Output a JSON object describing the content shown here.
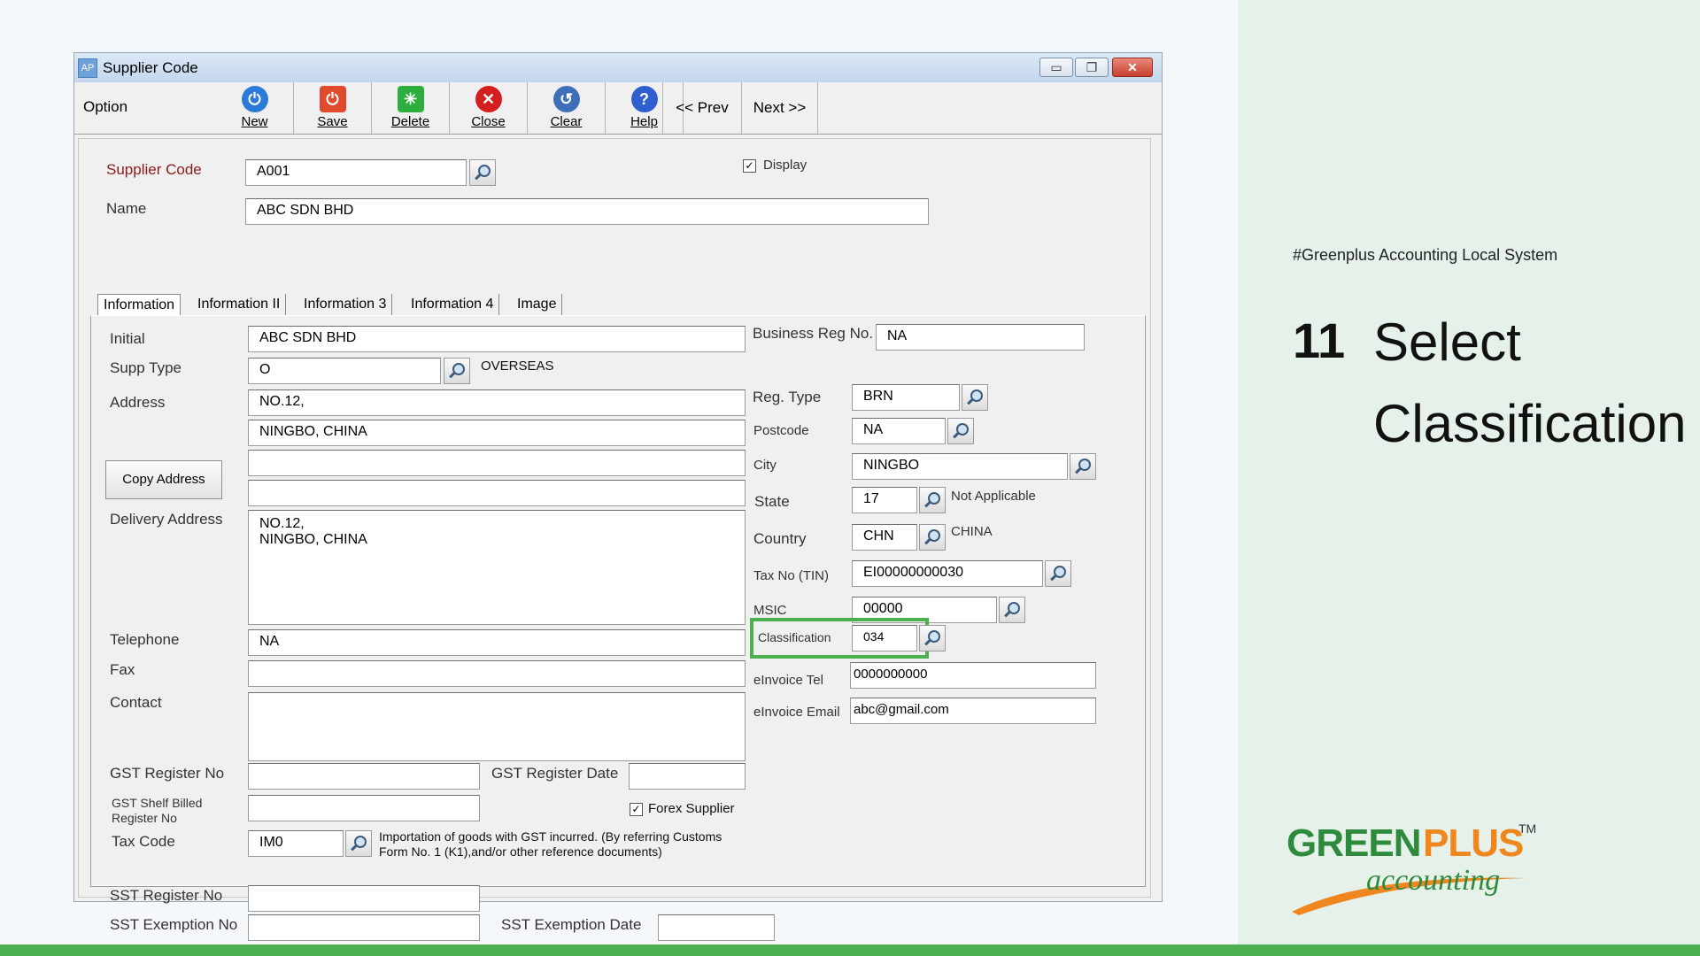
{
  "window": {
    "app_icon": "AP",
    "title": "Supplier Code",
    "controls": {
      "minimize": "▭",
      "maximize": "❐",
      "close": "✕"
    }
  },
  "toolbar": {
    "option_label": "Option",
    "buttons": [
      {
        "label": "New",
        "icon": "power-icon",
        "color": "#2a7ad8"
      },
      {
        "label": "Save",
        "icon": "save-icon",
        "color": "#e04b2e"
      },
      {
        "label": "Delete",
        "icon": "delete-icon",
        "color": "#2eae3e"
      },
      {
        "label": "Close",
        "icon": "close-icon",
        "color": "#d51f1f"
      },
      {
        "label": "Clear",
        "icon": "clear-icon",
        "color": "#3f6fb8"
      },
      {
        "label": "Help",
        "icon": "help-icon",
        "color": "#2f5fcf"
      }
    ],
    "prev_label": "<<  Prev",
    "next_label": "Next  >>"
  },
  "form": {
    "supplier_code_label": "Supplier Code",
    "supplier_code": "A001",
    "display_label": "Display",
    "display_checked": "✓",
    "name_label": "Name",
    "name": "ABC SDN BHD",
    "tabs": [
      "Information",
      "Information II",
      "Information 3",
      "Information 4",
      "Image"
    ],
    "initial_label": "Initial",
    "initial": "ABC SDN BHD",
    "supp_type_label": "Supp Type",
    "supp_type": "O",
    "supp_type_desc": "OVERSEAS",
    "address_label": "Address",
    "address1": "NO.12,",
    "address2": "NINGBO, CHINA",
    "address3": "",
    "address4": "",
    "copy_address_label": "Copy Address",
    "delivery_address_label": "Delivery Address",
    "delivery_address": "NO.12,\nNINGBO, CHINA",
    "telephone_label": "Telephone",
    "telephone": "NA",
    "fax_label": "Fax",
    "fax": "",
    "contact_label": "Contact",
    "contact": "",
    "gst_register_no_label": "GST Register No",
    "gst_register_date_label": "GST Register Date",
    "gst_shelf_label_1": "GST Shelf Billed",
    "gst_shelf_label_2": "Register No",
    "forex_label": "Forex Supplier",
    "forex_checked": "✓",
    "tax_code_label": "Tax Code",
    "tax_code": "IM0",
    "tax_code_desc_1": "Importation of goods with GST incurred. (By referring Customs",
    "tax_code_desc_2": "Form No. 1 (K1),and/or other reference documents)",
    "sst_register_no_label": "SST Register No",
    "sst_exemption_no_label": "SST Exemption No",
    "sst_exemption_date_label": "SST Exemption Date",
    "business_reg_label": "Business Reg No.",
    "business_reg": "NA",
    "reg_type_label": "Reg. Type",
    "reg_type": "BRN",
    "postcode_label": "Postcode",
    "postcode": "NA",
    "city_label": "City",
    "city": "NINGBO",
    "state_label": "State",
    "state": "17",
    "state_desc": "Not Applicable",
    "country_label": "Country",
    "country": "CHN",
    "country_desc": "CHINA",
    "tax_no_label": "Tax No (TIN)",
    "tax_no": "EI00000000030",
    "msic_label": "MSIC",
    "msic": "00000",
    "classification_label": "Classification",
    "classification": "034",
    "einvoice_tel_label": "eInvoice Tel",
    "einvoice_tel": "0000000000",
    "einvoice_email_label": "eInvoice Email",
    "einvoice_email": "abc@gmail.com"
  },
  "highlight_color": "#4caf50",
  "slide": {
    "hashtag": "#Greenplus Accounting Local System",
    "step_number": "11",
    "step_title_line1": "Select",
    "step_title_line2": "Classification"
  },
  "logo": {
    "text_green": "GREEN",
    "text_plus": "PLUS",
    "tm": "TM",
    "subtitle": "accounting"
  }
}
